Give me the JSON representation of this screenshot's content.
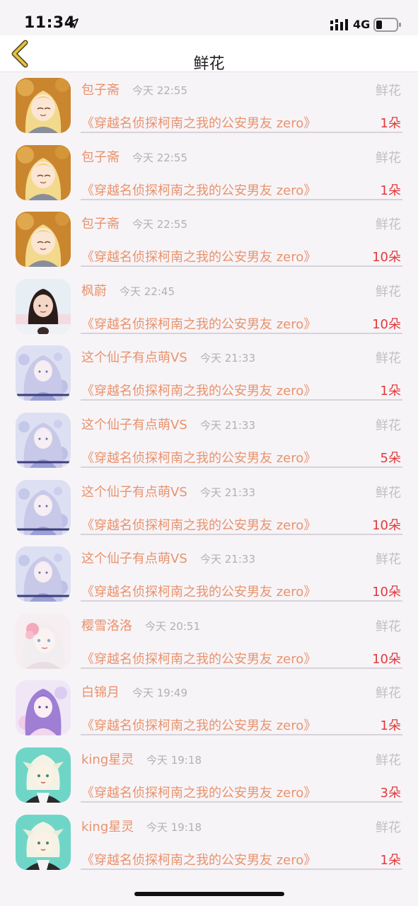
{
  "status_bar": {
    "time": "11:34",
    "network": "4G"
  },
  "nav": {
    "title": "鲜花"
  },
  "records": [
    {
      "avatar": "avatar-blonde-girl",
      "user": "包子斋",
      "time": "今天 22:55",
      "type": "鲜花",
      "book": "《穿越名侦探柯南之我的公安男友 zero》",
      "qty": "1朵"
    },
    {
      "avatar": "avatar-blonde-girl",
      "user": "包子斋",
      "time": "今天 22:55",
      "type": "鲜花",
      "book": "《穿越名侦探柯南之我的公安男友 zero》",
      "qty": "1朵"
    },
    {
      "avatar": "avatar-blonde-girl",
      "user": "包子斋",
      "time": "今天 22:55",
      "type": "鲜花",
      "book": "《穿越名侦探柯南之我的公安男友 zero》",
      "qty": "10朵"
    },
    {
      "avatar": "avatar-photo-girl",
      "user": "枫蔚",
      "time": "今天 22:45",
      "type": "鲜花",
      "book": "《穿越名侦探柯南之我的公安男友 zero》",
      "qty": "10朵"
    },
    {
      "avatar": "avatar-fairy-girl",
      "user": "这个仙子有点萌VS",
      "time": "今天 21:33",
      "type": "鲜花",
      "book": "《穿越名侦探柯南之我的公安男友 zero》",
      "qty": "1朵"
    },
    {
      "avatar": "avatar-fairy-girl",
      "user": "这个仙子有点萌VS",
      "time": "今天 21:33",
      "type": "鲜花",
      "book": "《穿越名侦探柯南之我的公安男友 zero》",
      "qty": "5朵"
    },
    {
      "avatar": "avatar-fairy-girl",
      "user": "这个仙子有点萌VS",
      "time": "今天 21:33",
      "type": "鲜花",
      "book": "《穿越名侦探柯南之我的公安男友 zero》",
      "qty": "10朵"
    },
    {
      "avatar": "avatar-fairy-girl",
      "user": "这个仙子有点萌VS",
      "time": "今天 21:33",
      "type": "鲜花",
      "book": "《穿越名侦探柯南之我的公安男友 zero》",
      "qty": "10朵"
    },
    {
      "avatar": "avatar-pink-flower-girl",
      "user": "樱雪洛洛",
      "time": "今天 20:51",
      "type": "鲜花",
      "book": "《穿越名侦探柯南之我的公安男友 zero》",
      "qty": "10朵"
    },
    {
      "avatar": "avatar-purple-girl",
      "user": "白锦月",
      "time": "今天 19:49",
      "type": "鲜花",
      "book": "《穿越名侦探柯南之我的公安男友 zero》",
      "qty": "1朵"
    },
    {
      "avatar": "avatar-teal-boy",
      "user": "king星灵",
      "time": "今天 19:18",
      "type": "鲜花",
      "book": "《穿越名侦探柯南之我的公安男友 zero》",
      "qty": "3朵"
    },
    {
      "avatar": "avatar-teal-boy",
      "user": "king星灵",
      "time": "今天 19:18",
      "type": "鲜花",
      "book": "《穿越名侦探柯南之我的公安男友 zero》",
      "qty": "1朵"
    }
  ],
  "colors": {
    "name": "#e8936c",
    "qty": "#e23a3a",
    "muted": "#c2bfc3",
    "back": "#e0b83a"
  }
}
